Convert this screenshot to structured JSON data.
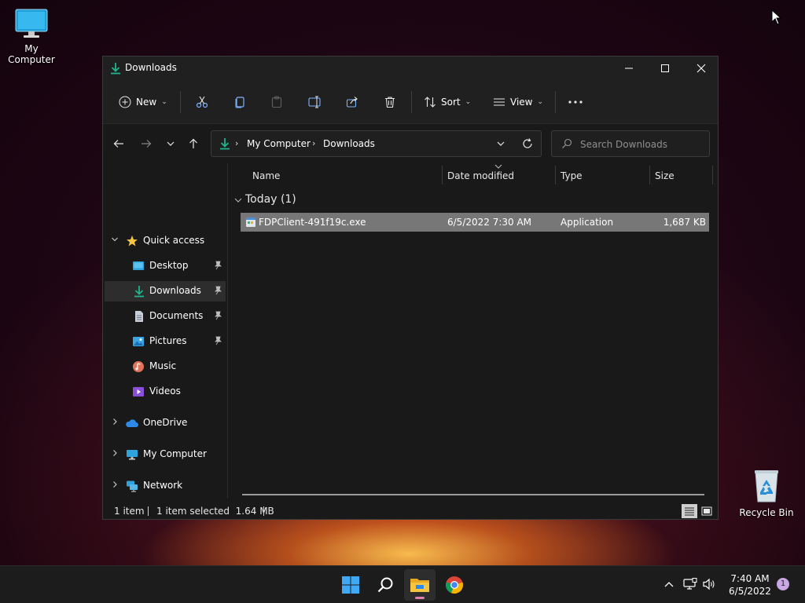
{
  "desktop": {
    "icons": [
      {
        "label": "My Computer"
      },
      {
        "label": "Recycle Bin"
      }
    ]
  },
  "window": {
    "title": "Downloads",
    "toolbar": {
      "new_label": "New",
      "sort_label": "Sort",
      "view_label": "View"
    },
    "address": {
      "crumbs": [
        "My Computer",
        "Downloads"
      ]
    },
    "search": {
      "placeholder": "Search Downloads"
    },
    "nav": {
      "quick_access": "Quick access",
      "items": [
        {
          "label": "Desktop"
        },
        {
          "label": "Downloads"
        },
        {
          "label": "Documents"
        },
        {
          "label": "Pictures"
        },
        {
          "label": "Music"
        },
        {
          "label": "Videos"
        }
      ],
      "onedrive": "OneDrive",
      "my_computer": "My Computer",
      "network": "Network"
    },
    "columns": {
      "name": "Name",
      "date": "Date modified",
      "type": "Type",
      "size": "Size"
    },
    "group": "Today (1)",
    "files": [
      {
        "name": "FDPClient-491f19c.exe",
        "date": "6/5/2022 7:30 AM",
        "type": "Application",
        "size": "1,687 KB"
      }
    ],
    "status": {
      "count": "1 item",
      "selected": "1 item selected  1.64 MB"
    }
  },
  "taskbar": {
    "time": "7:40 AM",
    "date": "6/5/2022",
    "notification_count": "1"
  },
  "colors": {
    "accent_green": "#1fb58f",
    "selection_row": "#777777",
    "folder_yellow": "#f5c542"
  }
}
